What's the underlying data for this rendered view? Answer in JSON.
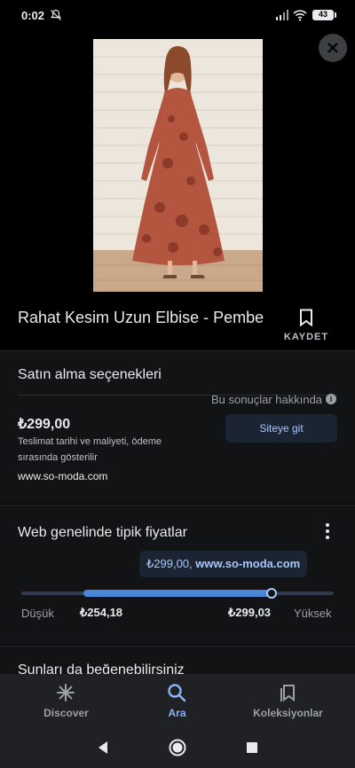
{
  "status": {
    "time": "0:02",
    "battery": "43"
  },
  "product": {
    "title": "Rahat Kesim Uzun Elbise - Pembe",
    "save_label": "KAYDET"
  },
  "purchase": {
    "heading": "Satın alma seçenekleri",
    "about_results": "Bu sonuçlar hakkında",
    "price": "₺299,00",
    "delivery_note": "Teslimat tarihi ve maliyeti, ödeme sırasında gösterilir",
    "site": "www.so-moda.com",
    "site_button": "Siteye git"
  },
  "typical_prices": {
    "heading": "Web genelinde tipik fiyatlar",
    "tooltip_price": "₺299,00, ",
    "tooltip_site": "www.so-moda.com",
    "low_label": "Düşük",
    "high_label": "Yüksek",
    "low_value": "₺254,18",
    "high_value": "₺299,03",
    "range_fill_start": 0.2,
    "range_fill_end": 0.8,
    "current_position": 0.8
  },
  "more": {
    "heading": "Şunları da beğenebilirsiniz"
  },
  "bottom_nav": [
    {
      "label": "Discover",
      "icon": "asterisk-icon",
      "active": false
    },
    {
      "label": "Ara",
      "icon": "search-icon",
      "active": true
    },
    {
      "label": "Koleksiyonlar",
      "icon": "collections-icon",
      "active": false
    }
  ],
  "colors": {
    "accent": "#8ab4f8",
    "card": "#121314",
    "nav": "#202124"
  }
}
